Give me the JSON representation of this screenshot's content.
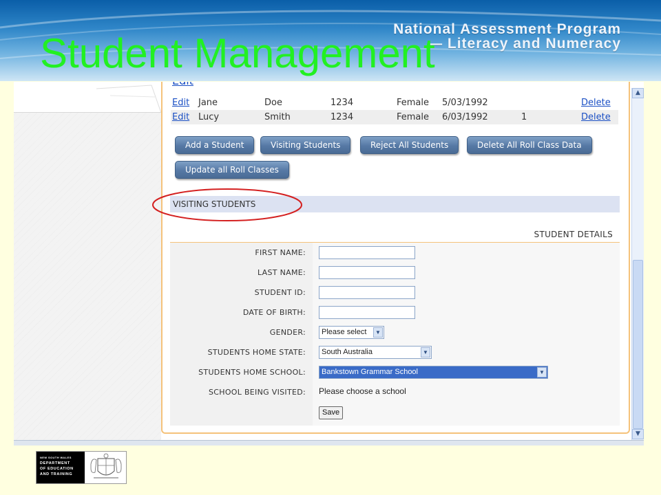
{
  "slide": {
    "title": "Student Management",
    "program_line1": "National Assessment Program",
    "program_line2": "— Literacy and Numeracy"
  },
  "students": {
    "rows": [
      {
        "edit": "Edit",
        "first": "Jane",
        "last": "Doe",
        "id": "1234",
        "gender": "Female",
        "dob": "5/03/1992",
        "num": "",
        "delete": "Delete"
      },
      {
        "edit": "Edit",
        "first": "Lucy",
        "last": "Smith",
        "id": "1234",
        "gender": "Female",
        "dob": "6/03/1992",
        "num": "1",
        "delete": "Delete"
      }
    ]
  },
  "buttons": {
    "add_student": "Add a Student",
    "visiting_students": "Visiting Students",
    "reject_all": "Reject All Students",
    "delete_all": "Delete All Roll Class Data",
    "update_roll": "Update all Roll Classes"
  },
  "visiting": {
    "section_title": "VISITING STUDENTS",
    "details_header": "STUDENT DETAILS",
    "labels": {
      "first_name": "FIRST NAME:",
      "last_name": "LAST NAME:",
      "student_id": "STUDENT ID:",
      "dob": "DATE OF BIRTH:",
      "gender": "GENDER:",
      "home_state": "STUDENTS HOME STATE:",
      "home_school": "STUDENTS HOME SCHOOL:",
      "school_visited": "SCHOOL BEING VISITED:"
    },
    "values": {
      "first_name": "",
      "last_name": "",
      "student_id": "",
      "dob": "",
      "gender": "Please select",
      "home_state": "South Australia",
      "home_school": "Bankstown Grammar School",
      "school_visited": "Please choose a school"
    },
    "save_label": "Save"
  },
  "logo": {
    "line_small": "NEW SOUTH WALES",
    "line1": "DEPARTMENT",
    "line2": "OF EDUCATION",
    "line3": "AND TRAINING"
  },
  "colors": {
    "title_green": "#22f022",
    "link_blue": "#1a4fc4",
    "button_blue": "#5679a5",
    "highlight_ellipse": "#d42020",
    "frame_orange": "#f5c27a"
  },
  "icons": {
    "scroll_up": "chevron-up-icon",
    "scroll_down": "chevron-down-icon",
    "select_arrow": "chevron-down-icon"
  }
}
